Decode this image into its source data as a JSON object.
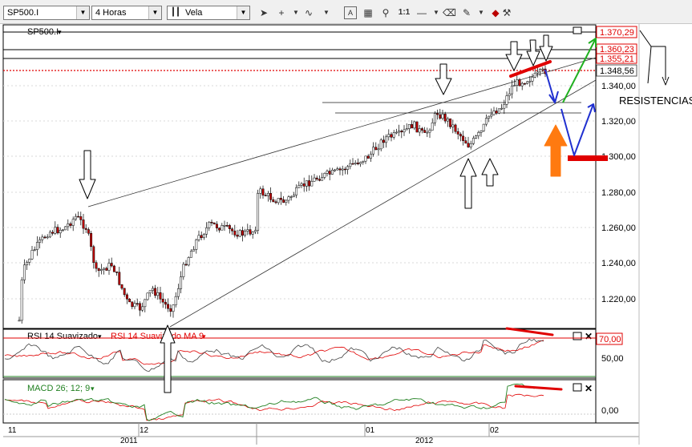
{
  "toolbar": {
    "symbol": "SP500.I",
    "timeframe": "4 Horas",
    "chart_style": "Vela",
    "zoom_label": "1:1",
    "icons": [
      "cursor-icon",
      "crosshair-icon",
      "dropdown-icon",
      "indicator-icon",
      "text-icon",
      "chart-type-icon",
      "zoom-in-icon",
      "ratio-icon",
      "line-icon",
      "dropdown-icon",
      "eraser-icon",
      "pencil-icon",
      "dropdown-icon",
      "color-icon"
    ]
  },
  "price_panel": {
    "title": "SP500.I",
    "y_ticks": [
      "1.340,00",
      "1.320,00",
      "1.300,00",
      "1.280,00",
      "1.260,00",
      "1.240,00",
      "1.220,00"
    ],
    "level_labels": [
      "1.370,29",
      "1.360,23",
      "1.355,21",
      "1.348,56"
    ],
    "annotation": "RESISTENCIAS"
  },
  "rsi_panel": {
    "title": "RSI 14 Suavizado",
    "ma_title": "RSI 14 Suavizado MA 9",
    "level_label": "70,00",
    "y_ticks": [
      "50,00"
    ]
  },
  "macd_panel": {
    "title": "MACD 26; 12; 9",
    "y_ticks": [
      "0,00"
    ]
  },
  "x_axis": {
    "month_labels": [
      "11",
      "12",
      "01",
      "02"
    ],
    "year_labels": [
      "2011",
      "2012"
    ]
  },
  "colors": {
    "bull": "#000000",
    "bear": "#c00000",
    "rsi_line": "#404040",
    "rsi_ma": "#e00000",
    "macd_line": "#208020",
    "macd_signal": "#e00000",
    "level_red": "#e00000",
    "arrow_green": "#20b020",
    "arrow_blue": "#2030d0",
    "arrow_orange": "#ff7a10"
  }
}
